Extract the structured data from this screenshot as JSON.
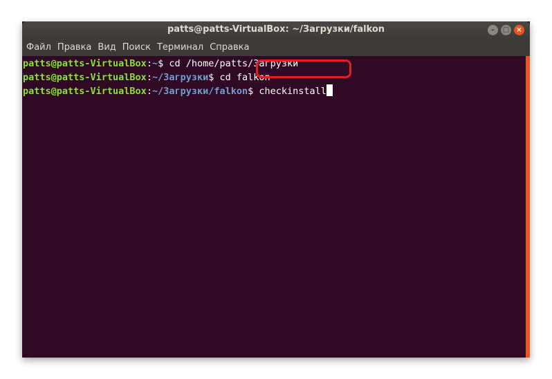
{
  "window": {
    "title": "patts@patts-VirtualBox: ~/Загрузки/falkon",
    "buttons": {
      "minimize": "–",
      "maximize": "□",
      "close": "×"
    }
  },
  "menu": [
    "Файл",
    "Правка",
    "Вид",
    "Поиск",
    "Терминал",
    "Справка"
  ],
  "terminal": {
    "lines": [
      {
        "user": "patts@patts-VirtualBox",
        "path": "~",
        "command": "cd /home/patts/Загрузки"
      },
      {
        "user": "patts@patts-VirtualBox",
        "path": "~/Загрузки",
        "command": "cd falkon"
      },
      {
        "user": "patts@patts-VirtualBox",
        "path": "~/Загрузки/falkon",
        "command": "checkinstall"
      }
    ],
    "prompt_sep": ":",
    "prompt_end": "$ "
  },
  "colors": {
    "background": "#300a24",
    "user": "#8ae234",
    "path": "#729fcf",
    "highlight": "#e02020",
    "accent": "#e95420"
  }
}
